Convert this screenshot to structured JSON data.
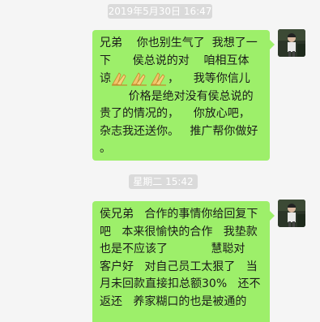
{
  "timestamps": {
    "first": "2019年5月30日 16:47",
    "second": "星期二 15:42"
  },
  "messages": [
    {
      "sender": "self",
      "lines": [
        "兄弟    你也别生气了  我想了一",
        "下      侯总说的对    咱相互体",
        "谅",
        "        价格是绝对没有侯总说的",
        "贵了的情况的，    你放心吧，",
        "杂志我还送你。   推广帮你做好",
        "。"
      ],
      "line3_suffix": "，    我等你信儿",
      "emoji": [
        "folded-hands",
        "folded-hands",
        "folded-hands"
      ]
    },
    {
      "sender": "self",
      "lines": [
        "侯兄弟   合作的事情你给回复下",
        "吧   本来很愉快的合作   我垫款",
        "也是不应该了            慧聪对",
        "客户好   对自己员工太狠了   当",
        "月未回款直接扣总额30%   还不",
        "返还   养家糊口的也是被通的"
      ]
    }
  ]
}
